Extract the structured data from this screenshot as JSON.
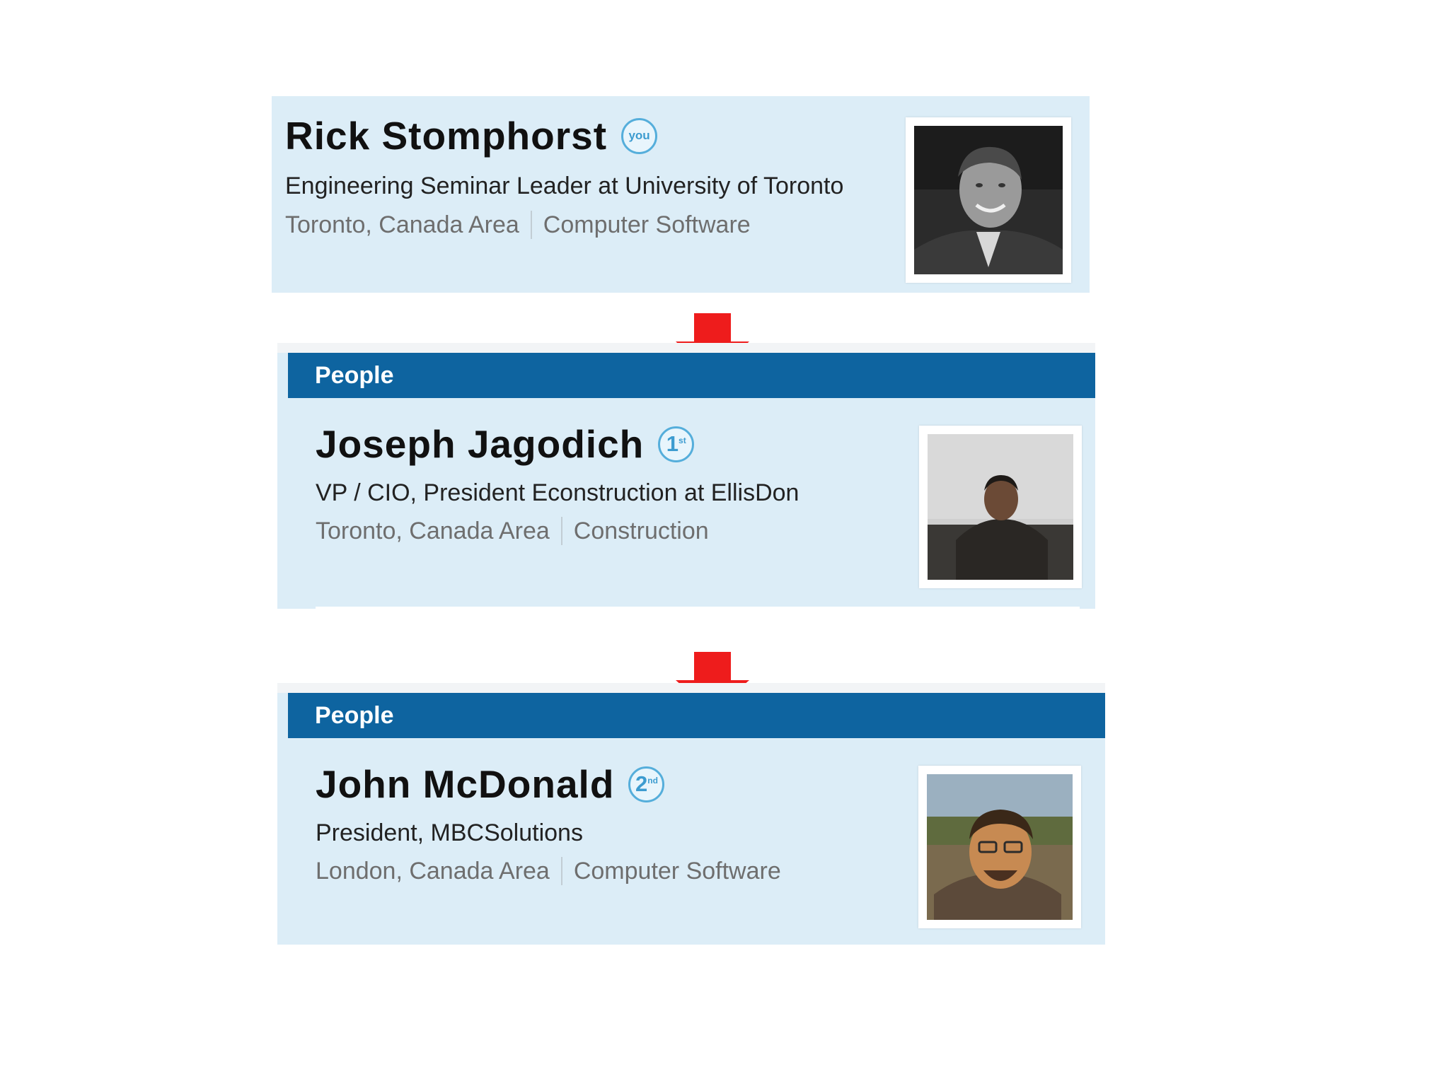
{
  "profiles": [
    {
      "name": "Rick Stomphorst",
      "degree_num": "you",
      "degree_suffix": "",
      "headline": "Engineering Seminar Leader at University of Toronto",
      "location": "Toronto, Canada Area",
      "industry": "Computer Software"
    },
    {
      "section": "People",
      "name": "Joseph Jagodich",
      "degree_num": "1",
      "degree_suffix": "st",
      "headline": "VP / CIO, President Econstruction at EllisDon",
      "location": "Toronto, Canada Area",
      "industry": "Construction"
    },
    {
      "section": "People",
      "name": "John McDonald",
      "degree_num": "2",
      "degree_suffix": "nd",
      "headline": "President, MBCSolutions",
      "location": "London, Canada Area",
      "industry": "Computer Software"
    }
  ],
  "colors": {
    "card_bg": "#dcedf7",
    "header_bar": "#0e64a0",
    "arrow": "#ee1c1c",
    "degree_badge": "#55aedb"
  },
  "icons": [
    "you-badge-icon",
    "first-degree-icon",
    "second-degree-icon",
    "arrow-down-icon",
    "profile-photo"
  ]
}
